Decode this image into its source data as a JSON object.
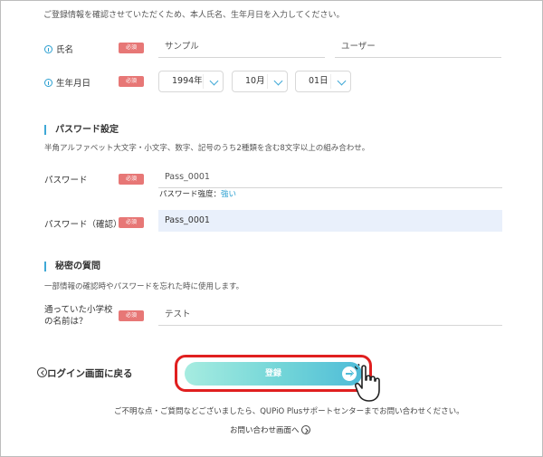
{
  "intro": "ご登録情報を確認させていただくため、本人氏名、生年月日を入力してください。",
  "required_label": "必須",
  "name": {
    "label": "氏名",
    "last_name": "サンプル",
    "first_name": "ユーザー"
  },
  "birthdate": {
    "label": "生年月日",
    "year": "1994年",
    "month": "10月",
    "day": "01日"
  },
  "password_section": {
    "title": "パスワード設定",
    "desc": "半角アルファベット大文字・小文字、数字、記号のうち2種類を含む8文字以上の組み合わせ。",
    "password_label": "パスワード",
    "password_value": "Pass_0001",
    "strength_label": "パスワード強度：",
    "strength_value": "強い",
    "confirm_label": "パスワード（確認）",
    "confirm_value": "Pass_0001"
  },
  "secret_section": {
    "title": "秘密の質問",
    "desc": "一部情報の確認時やパスワードを忘れた時に使用します。",
    "question_line1": "通っていた小学校",
    "question_line2": "の名前は？",
    "answer": "テスト"
  },
  "back_link": "ログイン画面に戻る",
  "submit_label": "登録",
  "footer_note": "ご不明な点・ご質問などございましたら、QUPiO Plusサポートセンターまでお問い合わせください。",
  "contact_link": "お問い合わせ画面へ",
  "colors": {
    "accent": "#3fa8d6",
    "required": "#e77776",
    "highlight": "#e01f1f"
  }
}
